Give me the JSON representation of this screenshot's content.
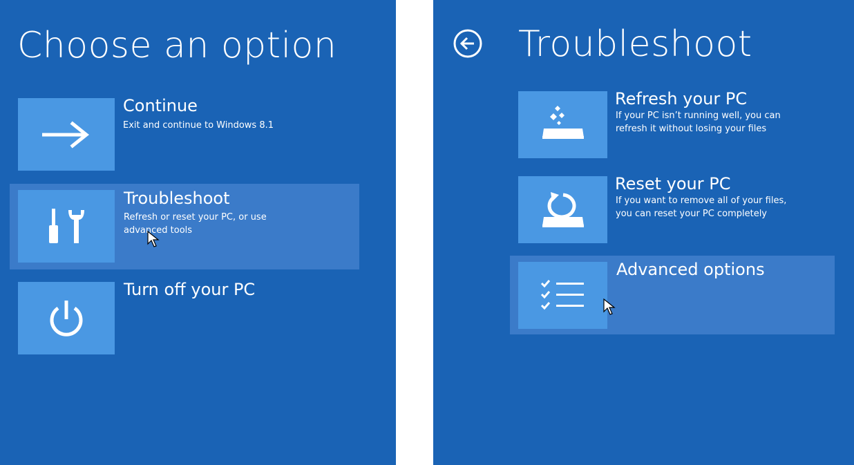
{
  "left": {
    "title": "Choose an option",
    "options": [
      {
        "title": "Continue",
        "desc": [
          "Exit and continue to Windows 8.1"
        ],
        "icon": "arrow-right-icon"
      },
      {
        "title": "Troubleshoot",
        "desc": [
          "Refresh or reset your PC, or use",
          "advanced tools"
        ],
        "icon": "tools-icon",
        "highlighted": true
      },
      {
        "title": "Turn off your PC",
        "desc": [],
        "icon": "power-icon"
      }
    ]
  },
  "right": {
    "title": "Troubleshoot",
    "back_icon": "back-arrow-icon",
    "options": [
      {
        "title": "Refresh your PC",
        "desc": [
          "If your PC isn’t running well, you can",
          "refresh it without losing your files"
        ],
        "icon": "refresh-pc-icon"
      },
      {
        "title": "Reset your PC",
        "desc": [
          "If you want to remove all of your files,",
          "you can reset your PC completely"
        ],
        "icon": "reset-pc-icon"
      },
      {
        "title": "Advanced options",
        "desc": [],
        "icon": "checklist-icon",
        "highlighted": true
      }
    ]
  },
  "colors": {
    "background": "#1a63b5",
    "tile": "#4a98e3",
    "highlight": "#3b7bc9",
    "text": "#ffffff"
  }
}
